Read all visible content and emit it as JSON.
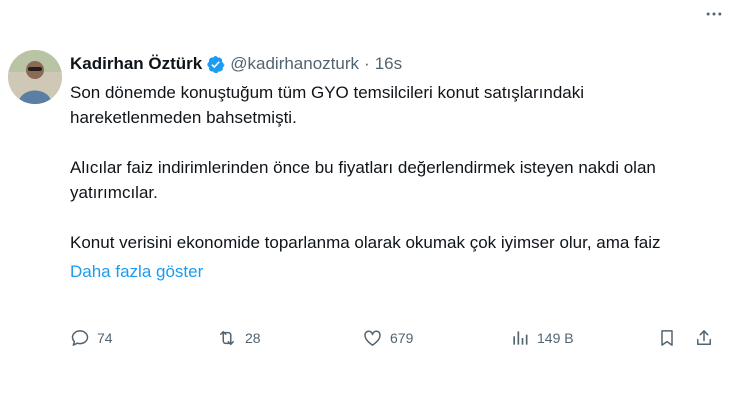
{
  "author": {
    "name": "Kadirhan Öztürk",
    "handle": "@kadirhanozturk",
    "separator": "·",
    "time": "16s"
  },
  "tweet": {
    "paragraphs": [
      "Son dönemde konuştuğum tüm GYO temsilcileri konut satışlarındaki hareketlenmeden bahsetmişti.",
      "Alıcılar faiz indirimlerinden önce bu fiyatları değerlendirmek isteyen nakdi olan yatırımcılar.",
      "Konut verisini ekonomide toparlanma olarak okumak çok iyimser olur, ama faiz"
    ],
    "show_more_label": "Daha fazla göster"
  },
  "actions": {
    "replies": "74",
    "reposts": "28",
    "likes": "679",
    "views": "149 B"
  },
  "colors": {
    "accent": "#1d9bf0",
    "muted": "#536471",
    "text": "#0f1419"
  },
  "icons": [
    "verified-badge-icon",
    "more-icon",
    "reply-icon",
    "repost-icon",
    "like-icon",
    "views-icon",
    "bookmark-icon",
    "share-icon"
  ]
}
